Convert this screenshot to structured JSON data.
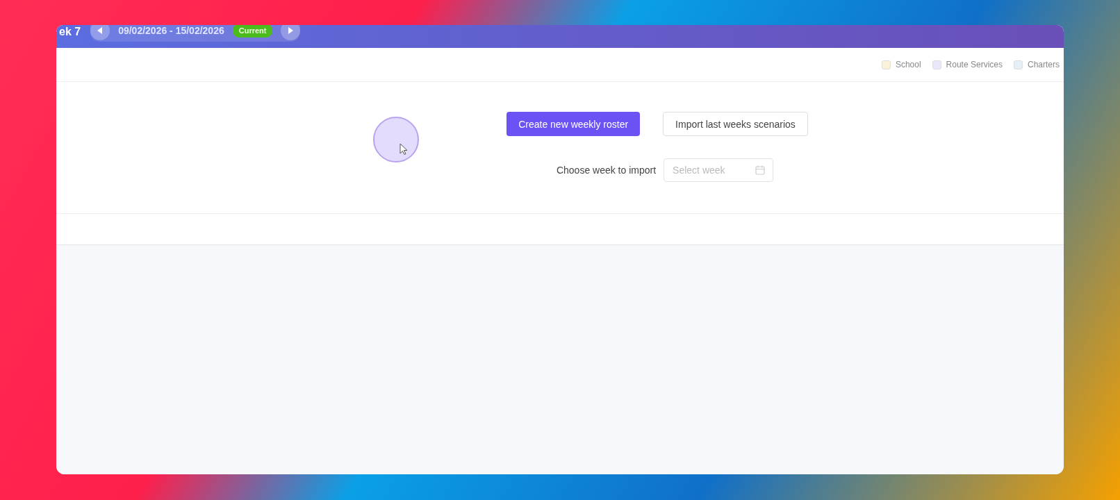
{
  "header": {
    "title": "ek 7",
    "date_range": "09/02/2026 - 15/02/2026",
    "badge": "Current"
  },
  "legend": [
    {
      "label": "School",
      "color": "#fbf3d9"
    },
    {
      "label": "Route Services",
      "color": "#ece6fb"
    },
    {
      "label": "Charters",
      "color": "#e6eef8"
    }
  ],
  "actions": {
    "create_button": "Create new weekly roster",
    "import_button": "Import last weeks scenarios"
  },
  "import_week": {
    "label": "Choose week to import",
    "placeholder": "Select week"
  }
}
